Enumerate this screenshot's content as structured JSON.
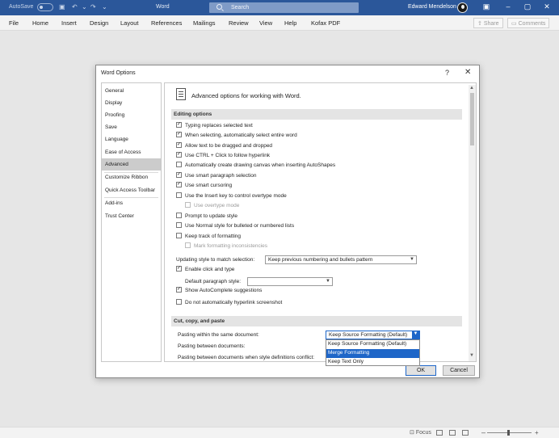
{
  "titlebar": {
    "autosave": "AutoSave",
    "toggle_state": "Off",
    "doc_name": "Word",
    "search_placeholder": "Search",
    "user_name": "Edward Mendelson"
  },
  "ribbon": {
    "tabs": [
      "File",
      "Home",
      "Insert",
      "Design",
      "Layout",
      "References",
      "Mailings",
      "Review",
      "View",
      "Help",
      "Kofax PDF"
    ],
    "share_label": "Share",
    "comments_label": "Comments"
  },
  "statusbar": {
    "focus_label": "Focus"
  },
  "dialog": {
    "title": "Word Options",
    "help": "?",
    "close": "✕",
    "nav": [
      "General",
      "Display",
      "Proofing",
      "Save",
      "Language",
      "Ease of Access",
      "Advanced",
      "Customize Ribbon",
      "Quick Access Toolbar",
      "Add-ins",
      "Trust Center"
    ],
    "nav_active": "Advanced",
    "panel_heading": "Advanced options for working with Word.",
    "editing_section": "Editing options",
    "editing_options": [
      {
        "label": "Typing replaces selected text",
        "checked": true
      },
      {
        "label": "When selecting, automatically select entire word",
        "checked": true
      },
      {
        "label": "Allow text to be dragged and dropped",
        "checked": true
      },
      {
        "label": "Use CTRL + Click to follow hyperlink",
        "checked": true
      },
      {
        "label": "Automatically create drawing canvas when inserting AutoShapes",
        "checked": false
      },
      {
        "label": "Use smart paragraph selection",
        "checked": true
      },
      {
        "label": "Use smart cursoring",
        "checked": true
      },
      {
        "label": "Use the Insert key to control overtype mode",
        "checked": false
      },
      {
        "label": "Use overtype mode",
        "checked": false,
        "disabled": true
      },
      {
        "label": "Prompt to update style",
        "checked": false
      },
      {
        "label": "Use Normal style for bulleted or numbered lists",
        "checked": false
      },
      {
        "label": "Keep track of formatting",
        "checked": false
      },
      {
        "label": "Mark formatting inconsistencies",
        "checked": false,
        "disabled": true
      }
    ],
    "updating_style_label": "Updating style to match selection:",
    "updating_style_value": "Keep previous numbering and bullets pattern",
    "click_and_type": {
      "label": "Enable click and type",
      "checked": true
    },
    "default_paragraph_label": "Default paragraph style:",
    "default_paragraph_value": "",
    "autocomplete": {
      "label": "Show AutoComplete suggestions",
      "checked": true
    },
    "no_hyperlink": {
      "label": "Do not automatically hyperlink screenshot",
      "checked": false
    },
    "cut_section": "Cut, copy, and paste",
    "pasting_same_label": "Pasting within the same document:",
    "pasting_same_value": "Keep Source Formatting (Default)",
    "pasting_between_label": "Pasting between documents:",
    "pasting_between_style_label": "Pasting between documents when style definitions conflict:",
    "dropdown_options": [
      "Keep Source Formatting (Default)",
      "Merge Formatting",
      "Keep Text Only"
    ],
    "dropdown_highlighted": "Merge Formatting",
    "ok_label": "OK",
    "cancel_label": "Cancel"
  },
  "colors": {
    "titlebar_bg": "#2b579a",
    "selection_blue": "#1e66c8",
    "nav_active_bg": "#cccccc"
  }
}
